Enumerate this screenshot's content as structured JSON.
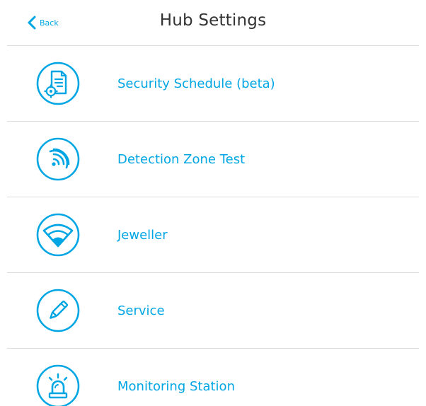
{
  "header": {
    "back_label": "Back",
    "title": "Hub Settings"
  },
  "menu": {
    "items": [
      {
        "label": "Security Schedule (beta)",
        "icon": "schedule-document-gear-icon"
      },
      {
        "label": "Detection Zone Test",
        "icon": "signal-waves-icon"
      },
      {
        "label": "Jeweller",
        "icon": "wifi-signal-icon"
      },
      {
        "label": "Service",
        "icon": "pencil-icon"
      },
      {
        "label": "Monitoring Station",
        "icon": "alarm-siren-icon"
      }
    ]
  },
  "colors": {
    "accent": "#00a6e4",
    "title_text": "#333333",
    "divider": "#dcdcdc",
    "background": "#ffffff"
  }
}
